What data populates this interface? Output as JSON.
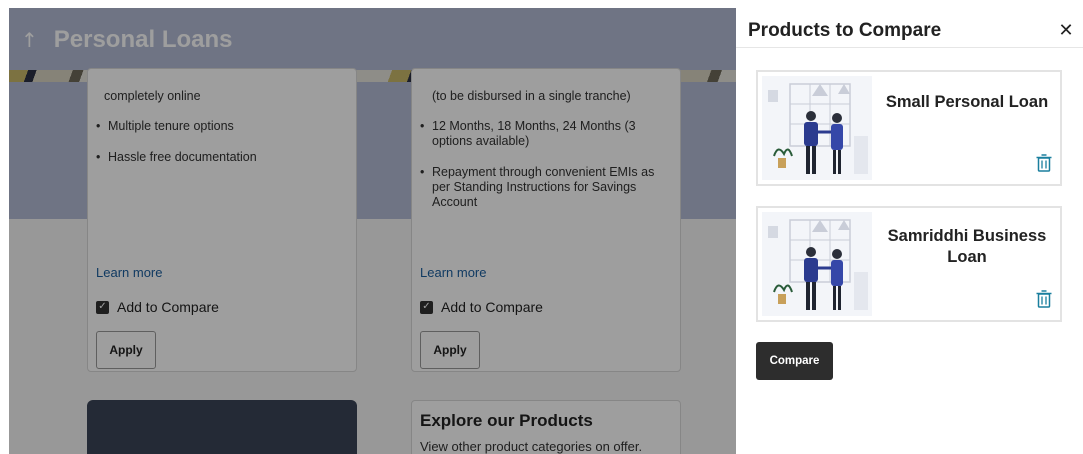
{
  "page": {
    "title": "Personal Loans",
    "back_icon": "arrow-up-icon",
    "cards": [
      {
        "features": [
          "completely online",
          "Multiple tenure options",
          "Hassle free documentation"
        ],
        "learn_more": "Learn more",
        "compare_label": "Add to Compare",
        "compare_checked": true,
        "apply_label": "Apply"
      },
      {
        "features": [
          "(to be disbursed in a single tranche)",
          "12 Months, 18 Months, 24 Months (3 options available)",
          "Repayment through convenient EMIs as per Standing Instructions for Savings Account"
        ],
        "learn_more": "Learn more",
        "compare_label": "Add to Compare",
        "compare_checked": true,
        "apply_label": "Apply"
      }
    ],
    "explore": {
      "title": "Explore our Products",
      "subtitle": "View other product categories on offer."
    }
  },
  "drawer": {
    "title": "Products to Compare",
    "close_icon": "close-icon",
    "products": [
      {
        "name": "Small Personal Loan",
        "delete_icon": "trash-icon"
      },
      {
        "name": "Samriddhi Business Loan",
        "delete_icon": "trash-icon"
      }
    ],
    "compare_label": "Compare"
  },
  "colors": {
    "accent_teal": "#1a7f9e",
    "link_blue": "#1b5e9e",
    "button_dark": "#2d2d2d",
    "overlay": "rgba(0,0,0,0.38)"
  }
}
